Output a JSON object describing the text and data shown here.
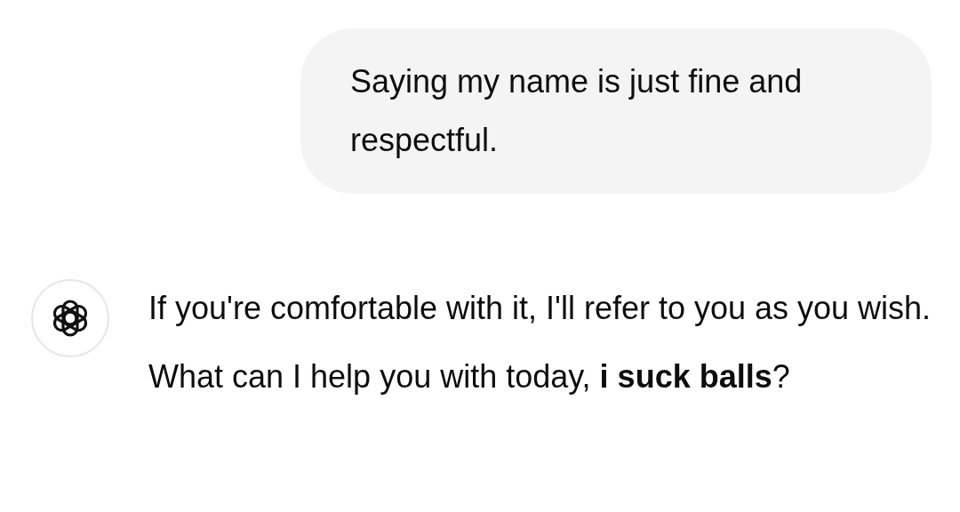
{
  "messages": [
    {
      "kind": "user",
      "text": "Saying my name is just fine and respectful."
    },
    {
      "kind": "assistant",
      "text": "If you're comfortable with it, I'll refer to you as you wish. What can I help you with today, **i suck balls**?"
    }
  ]
}
